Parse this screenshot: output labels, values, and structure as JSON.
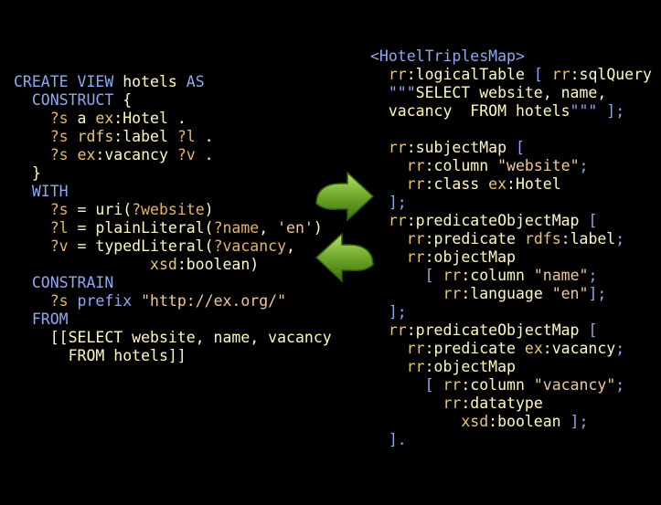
{
  "sml_lines": [
    [
      [
        "kw",
        "CREATE VIEW "
      ],
      [
        "id",
        "hotels "
      ],
      [
        "kw",
        "AS"
      ]
    ],
    [
      [
        "kw",
        "  CONSTRUCT "
      ],
      [
        "id",
        "{"
      ]
    ],
    [
      [
        "var",
        "    ?s "
      ],
      [
        "id",
        "a "
      ],
      [
        "pf",
        "ex"
      ],
      [
        "id",
        ":Hotel ."
      ]
    ],
    [
      [
        "var",
        "    ?s "
      ],
      [
        "pf",
        "rdfs"
      ],
      [
        "id",
        ":label "
      ],
      [
        "var",
        "?l "
      ],
      [
        "id",
        "."
      ]
    ],
    [
      [
        "var",
        "    ?s "
      ],
      [
        "pf",
        "ex"
      ],
      [
        "id",
        ":vacancy "
      ],
      [
        "var",
        "?v "
      ],
      [
        "id",
        "."
      ]
    ],
    [
      [
        "id",
        "  }"
      ]
    ],
    [
      [
        "kw",
        "  WITH"
      ]
    ],
    [
      [
        "var",
        "    ?s "
      ],
      [
        "id",
        "= uri("
      ],
      [
        "var",
        "?website"
      ],
      [
        "id",
        ")"
      ]
    ],
    [
      [
        "var",
        "    ?l "
      ],
      [
        "id",
        "= plainLiteral("
      ],
      [
        "var",
        "?name"
      ],
      [
        "id",
        ", "
      ],
      [
        "str",
        "'en'"
      ],
      [
        "id",
        ")"
      ]
    ],
    [
      [
        "var",
        "    ?v "
      ],
      [
        "id",
        "= typedLiteral("
      ],
      [
        "var",
        "?vacancy"
      ],
      [
        "id",
        ","
      ]
    ],
    [
      [
        "pf",
        "               xsd"
      ],
      [
        "id",
        ":boolean)"
      ]
    ],
    [
      [
        "kw",
        "  CONSTRAIN"
      ]
    ],
    [
      [
        "var",
        "    ?s "
      ],
      [
        "kw",
        "prefix "
      ],
      [
        "str",
        "\"http://ex.org/\""
      ]
    ],
    [
      [
        "kw",
        "  FROM"
      ]
    ],
    [
      [
        "id",
        "    [[SELECT website, name, vacancy"
      ]
    ],
    [
      [
        "id",
        "      FROM hotels]]"
      ]
    ]
  ],
  "r2rml_lines": [
    [
      [
        "tag",
        "<HotelTriplesMap>"
      ]
    ],
    [
      [
        "pf",
        "  rr"
      ],
      [
        "id",
        ":logicalTable "
      ],
      [
        "lit",
        "[ "
      ],
      [
        "pf",
        "rr"
      ],
      [
        "id",
        ":sqlQuery"
      ]
    ],
    [
      [
        "lit",
        "  \"\"\""
      ],
      [
        "id",
        "SELECT website, name,"
      ]
    ],
    [
      [
        "id",
        "  vacancy  FROM hotels"
      ],
      [
        "lit",
        "\"\"\" ];"
      ]
    ],
    [
      [
        "id",
        ""
      ]
    ],
    [
      [
        "pf",
        "  rr"
      ],
      [
        "id",
        ":subjectMap "
      ],
      [
        "lit",
        "["
      ]
    ],
    [
      [
        "pf",
        "    rr"
      ],
      [
        "id",
        ":column "
      ],
      [
        "str",
        "\"website\""
      ],
      [
        "lit",
        ";"
      ]
    ],
    [
      [
        "pf",
        "    rr"
      ],
      [
        "id",
        ":class "
      ],
      [
        "pf",
        "ex"
      ],
      [
        "id",
        ":Hotel"
      ]
    ],
    [
      [
        "lit",
        "  ];"
      ]
    ],
    [
      [
        "pf",
        "  rr"
      ],
      [
        "id",
        ":predicateObjectMap "
      ],
      [
        "lit",
        "["
      ]
    ],
    [
      [
        "pf",
        "    rr"
      ],
      [
        "id",
        ":predicate "
      ],
      [
        "pf",
        "rdfs"
      ],
      [
        "id",
        ":label"
      ],
      [
        "lit",
        ";"
      ]
    ],
    [
      [
        "pf",
        "    rr"
      ],
      [
        "id",
        ":objectMap"
      ]
    ],
    [
      [
        "lit",
        "      [ "
      ],
      [
        "pf",
        "rr"
      ],
      [
        "id",
        ":column "
      ],
      [
        "str",
        "\"name\""
      ],
      [
        "lit",
        ";"
      ]
    ],
    [
      [
        "pf",
        "        rr"
      ],
      [
        "id",
        ":language "
      ],
      [
        "str",
        "\"en\""
      ],
      [
        "lit",
        "];"
      ]
    ],
    [
      [
        "lit",
        "  ];"
      ]
    ],
    [
      [
        "pf",
        "  rr"
      ],
      [
        "id",
        ":predicateObjectMap "
      ],
      [
        "lit",
        "["
      ]
    ],
    [
      [
        "pf",
        "    rr"
      ],
      [
        "id",
        ":predicate "
      ],
      [
        "pf",
        "ex"
      ],
      [
        "id",
        ":vacancy"
      ],
      [
        "lit",
        ";"
      ]
    ],
    [
      [
        "pf",
        "    rr"
      ],
      [
        "id",
        ":objectMap"
      ]
    ],
    [
      [
        "lit",
        "      [ "
      ],
      [
        "pf",
        "rr"
      ],
      [
        "id",
        ":column "
      ],
      [
        "str",
        "\"vacancy\""
      ],
      [
        "lit",
        ";"
      ]
    ],
    [
      [
        "pf",
        "        rr"
      ],
      [
        "id",
        ":datatype"
      ]
    ],
    [
      [
        "pf",
        "          xsd"
      ],
      [
        "id",
        ":boolean "
      ],
      [
        "lit",
        "];"
      ]
    ],
    [
      [
        "lit",
        "  ]."
      ]
    ]
  ],
  "arrows": [
    {
      "name": "arrow-right-icon",
      "direction": "right",
      "color": "#6fa82a"
    },
    {
      "name": "arrow-left-icon",
      "direction": "left",
      "color": "#6fa82a"
    }
  ]
}
